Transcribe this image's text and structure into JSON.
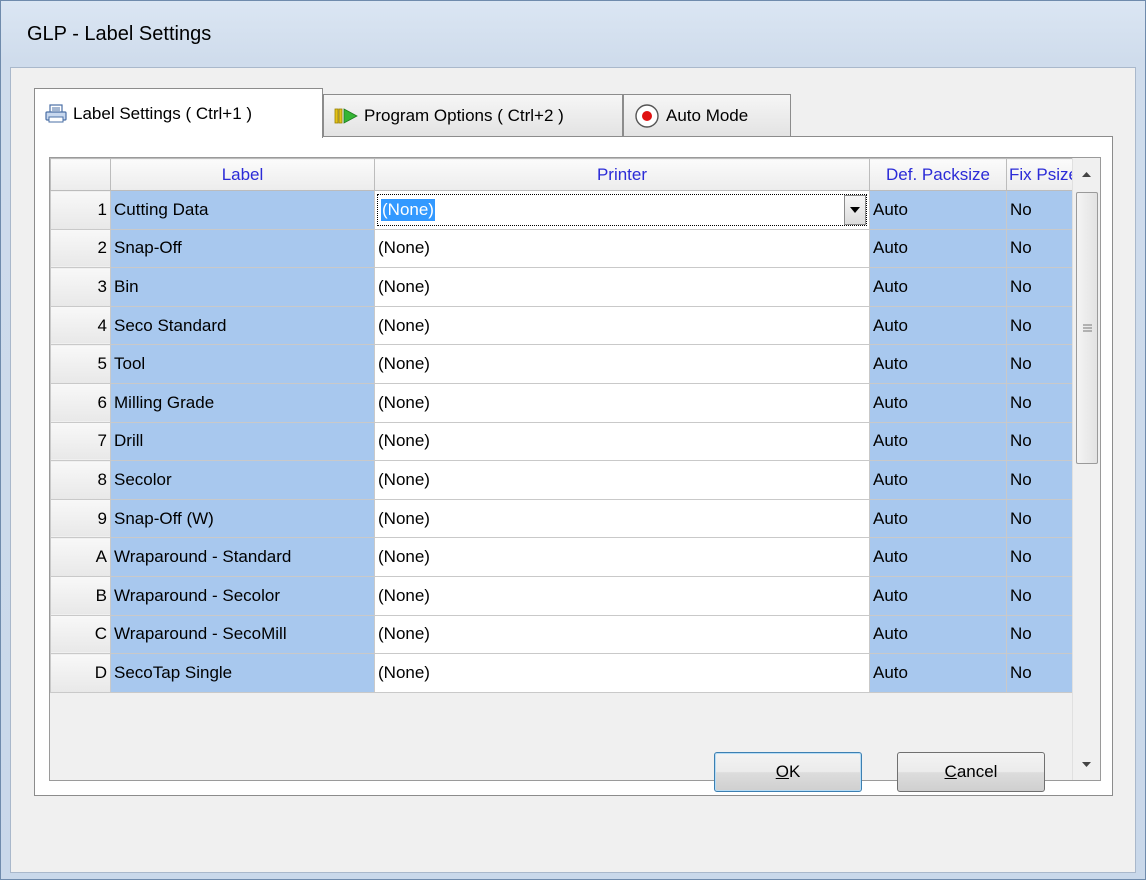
{
  "window": {
    "title": "GLP - Label Settings"
  },
  "tabs": [
    {
      "label": "Label Settings ( Ctrl+1 )",
      "icon": "printer-icon",
      "active": true
    },
    {
      "label": "Program Options ( Ctrl+2 )",
      "icon": "play-options-icon",
      "active": false
    },
    {
      "label": "Auto Mode",
      "icon": "record-icon",
      "active": false
    }
  ],
  "grid": {
    "columns": [
      "Label",
      "Printer",
      "Def. Packsize",
      "Fix Psize"
    ],
    "rows": [
      {
        "num": "1",
        "label": "Cutting Data",
        "printer": "(None)",
        "packsize": "Auto",
        "fix": "No"
      },
      {
        "num": "2",
        "label": "Snap-Off",
        "printer": "(None)",
        "packsize": "Auto",
        "fix": "No"
      },
      {
        "num": "3",
        "label": "Bin",
        "printer": "(None)",
        "packsize": "Auto",
        "fix": "No"
      },
      {
        "num": "4",
        "label": "Seco Standard",
        "printer": "(None)",
        "packsize": "Auto",
        "fix": "No"
      },
      {
        "num": "5",
        "label": "Tool",
        "printer": "(None)",
        "packsize": "Auto",
        "fix": "No"
      },
      {
        "num": "6",
        "label": "Milling Grade",
        "printer": "(None)",
        "packsize": "Auto",
        "fix": "No"
      },
      {
        "num": "7",
        "label": "Drill",
        "printer": "(None)",
        "packsize": "Auto",
        "fix": "No"
      },
      {
        "num": "8",
        "label": "Secolor",
        "printer": "(None)",
        "packsize": "Auto",
        "fix": "No"
      },
      {
        "num": "9",
        "label": "Snap-Off (W)",
        "printer": "(None)",
        "packsize": "Auto",
        "fix": "No"
      },
      {
        "num": "A",
        "label": "Wraparound - Standard",
        "printer": "(None)",
        "packsize": "Auto",
        "fix": "No"
      },
      {
        "num": "B",
        "label": "Wraparound - Secolor",
        "printer": "(None)",
        "packsize": "Auto",
        "fix": "No"
      },
      {
        "num": "C",
        "label": "Wraparound - SecoMill",
        "printer": "(None)",
        "packsize": "Auto",
        "fix": "No"
      },
      {
        "num": "D",
        "label": "SecoTap Single",
        "printer": "(None)",
        "packsize": "Auto",
        "fix": "No"
      }
    ]
  },
  "buttons": {
    "ok": {
      "accel": "O",
      "rest": "K"
    },
    "cancel": {
      "accel": "C",
      "rest": "ancel"
    }
  },
  "colors": {
    "header_text": "#2b2bd7",
    "cell_blue": "#a8c8ee",
    "selection": "#3399ff"
  }
}
